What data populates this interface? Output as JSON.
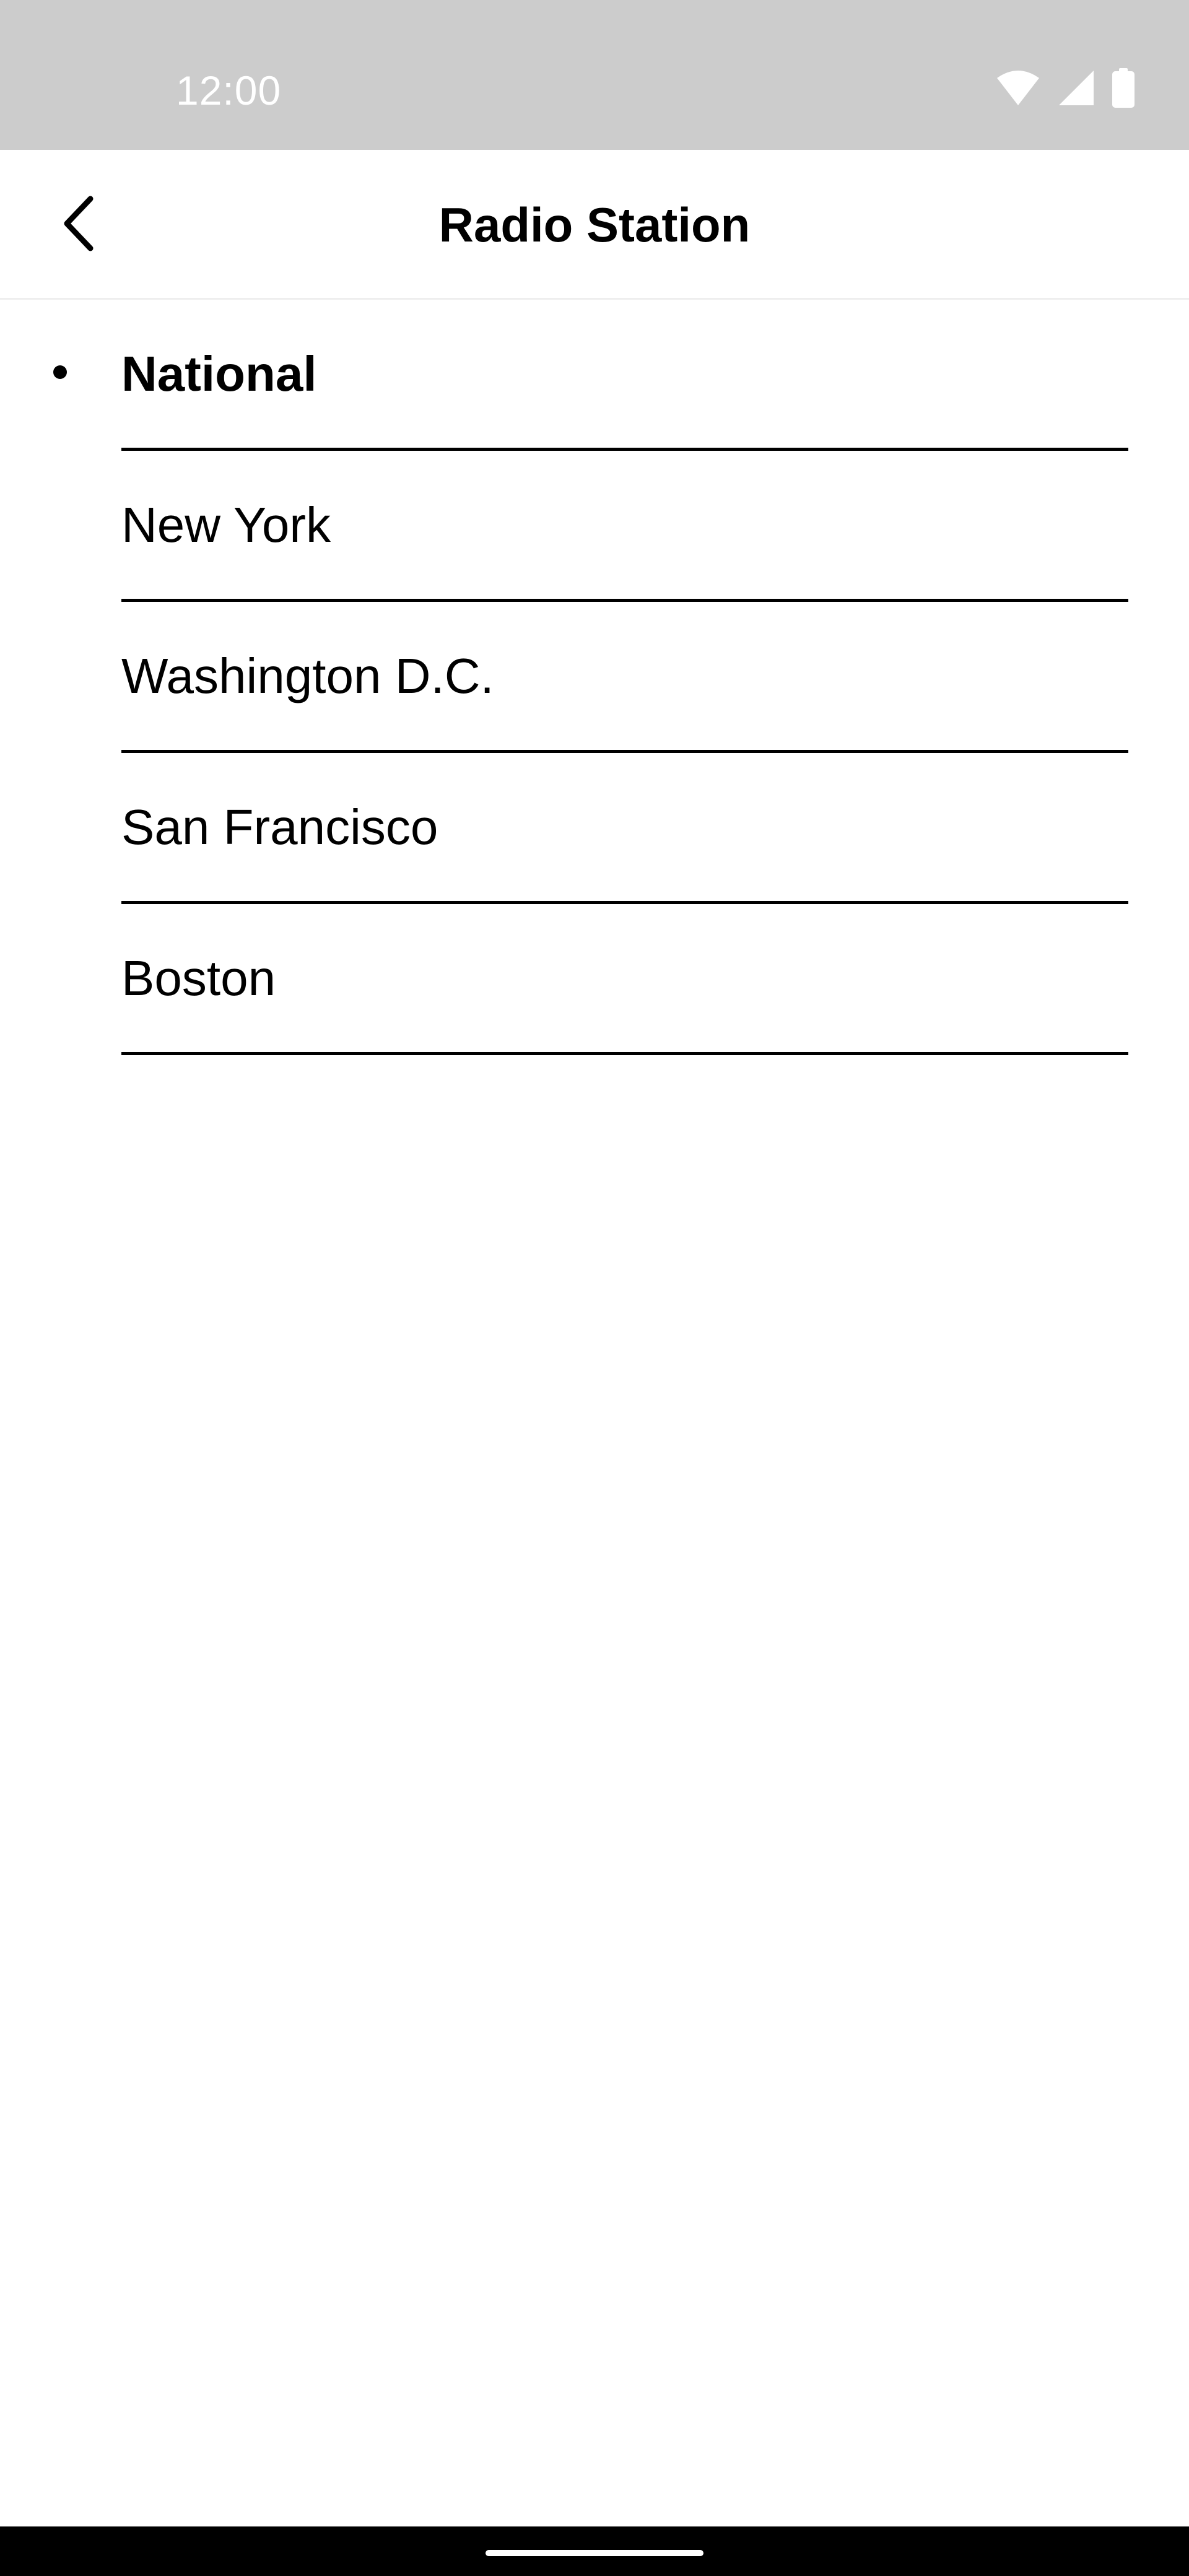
{
  "status_bar": {
    "time": "12:00",
    "icons": [
      "wifi-icon",
      "signal-icon",
      "battery-icon"
    ],
    "background": "#cccccc"
  },
  "app_bar": {
    "title": "Radio Station",
    "back_icon": "chevron-left-icon"
  },
  "stations": [
    {
      "label": "National",
      "selected": true
    },
    {
      "label": "New York",
      "selected": false
    },
    {
      "label": "Washington D.C.",
      "selected": false
    },
    {
      "label": "San Francisco",
      "selected": false
    },
    {
      "label": "Boston",
      "selected": false
    }
  ]
}
